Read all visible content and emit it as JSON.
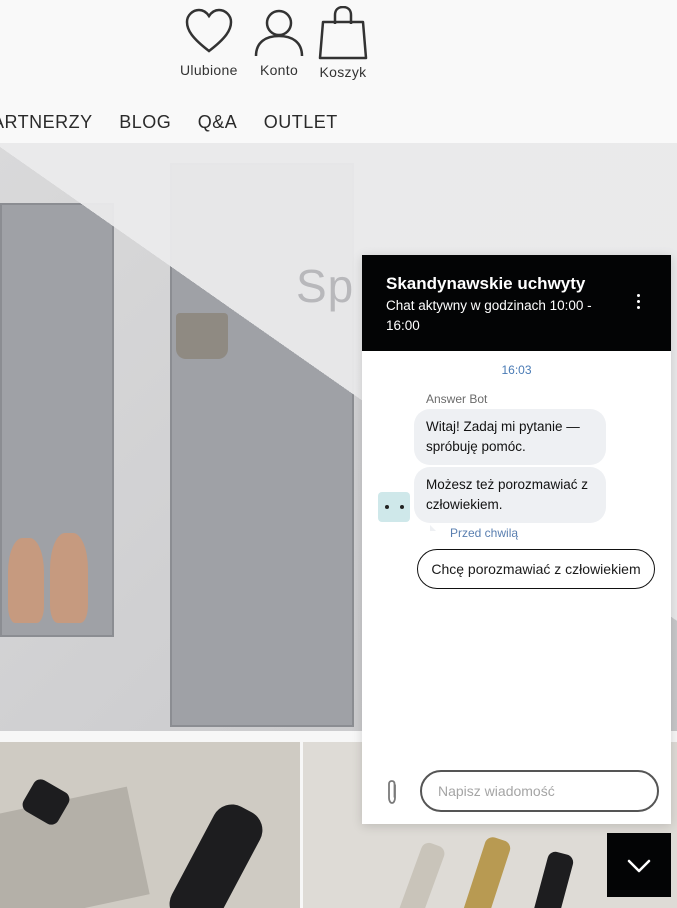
{
  "header": {
    "icons": [
      {
        "label": "Ulubione",
        "icon": "heart-icon"
      },
      {
        "label": "Konto",
        "icon": "user-icon"
      },
      {
        "label": "Koszyk",
        "icon": "bag-icon"
      }
    ],
    "nav": [
      "ARTNERZY",
      "BLOG",
      "Q&A",
      "OUTLET"
    ]
  },
  "hero": {
    "title": "Sp"
  },
  "chat": {
    "title": "Skandynawskie uchwyty",
    "subtitle": "Chat aktywny w godzinach 10:00 - 16:00",
    "time": "16:03",
    "bot_name": "Answer Bot",
    "messages": [
      "Witaj! Zadaj mi pytanie — spróbuję pomóc.",
      "Możesz też porozmawiać z człowiekiem."
    ],
    "status": "Przed chwilą",
    "human_button": "Chcę porozmawiać z człowiekiem",
    "input_placeholder": "Napisz wiadomość",
    "accent": "#030405"
  }
}
